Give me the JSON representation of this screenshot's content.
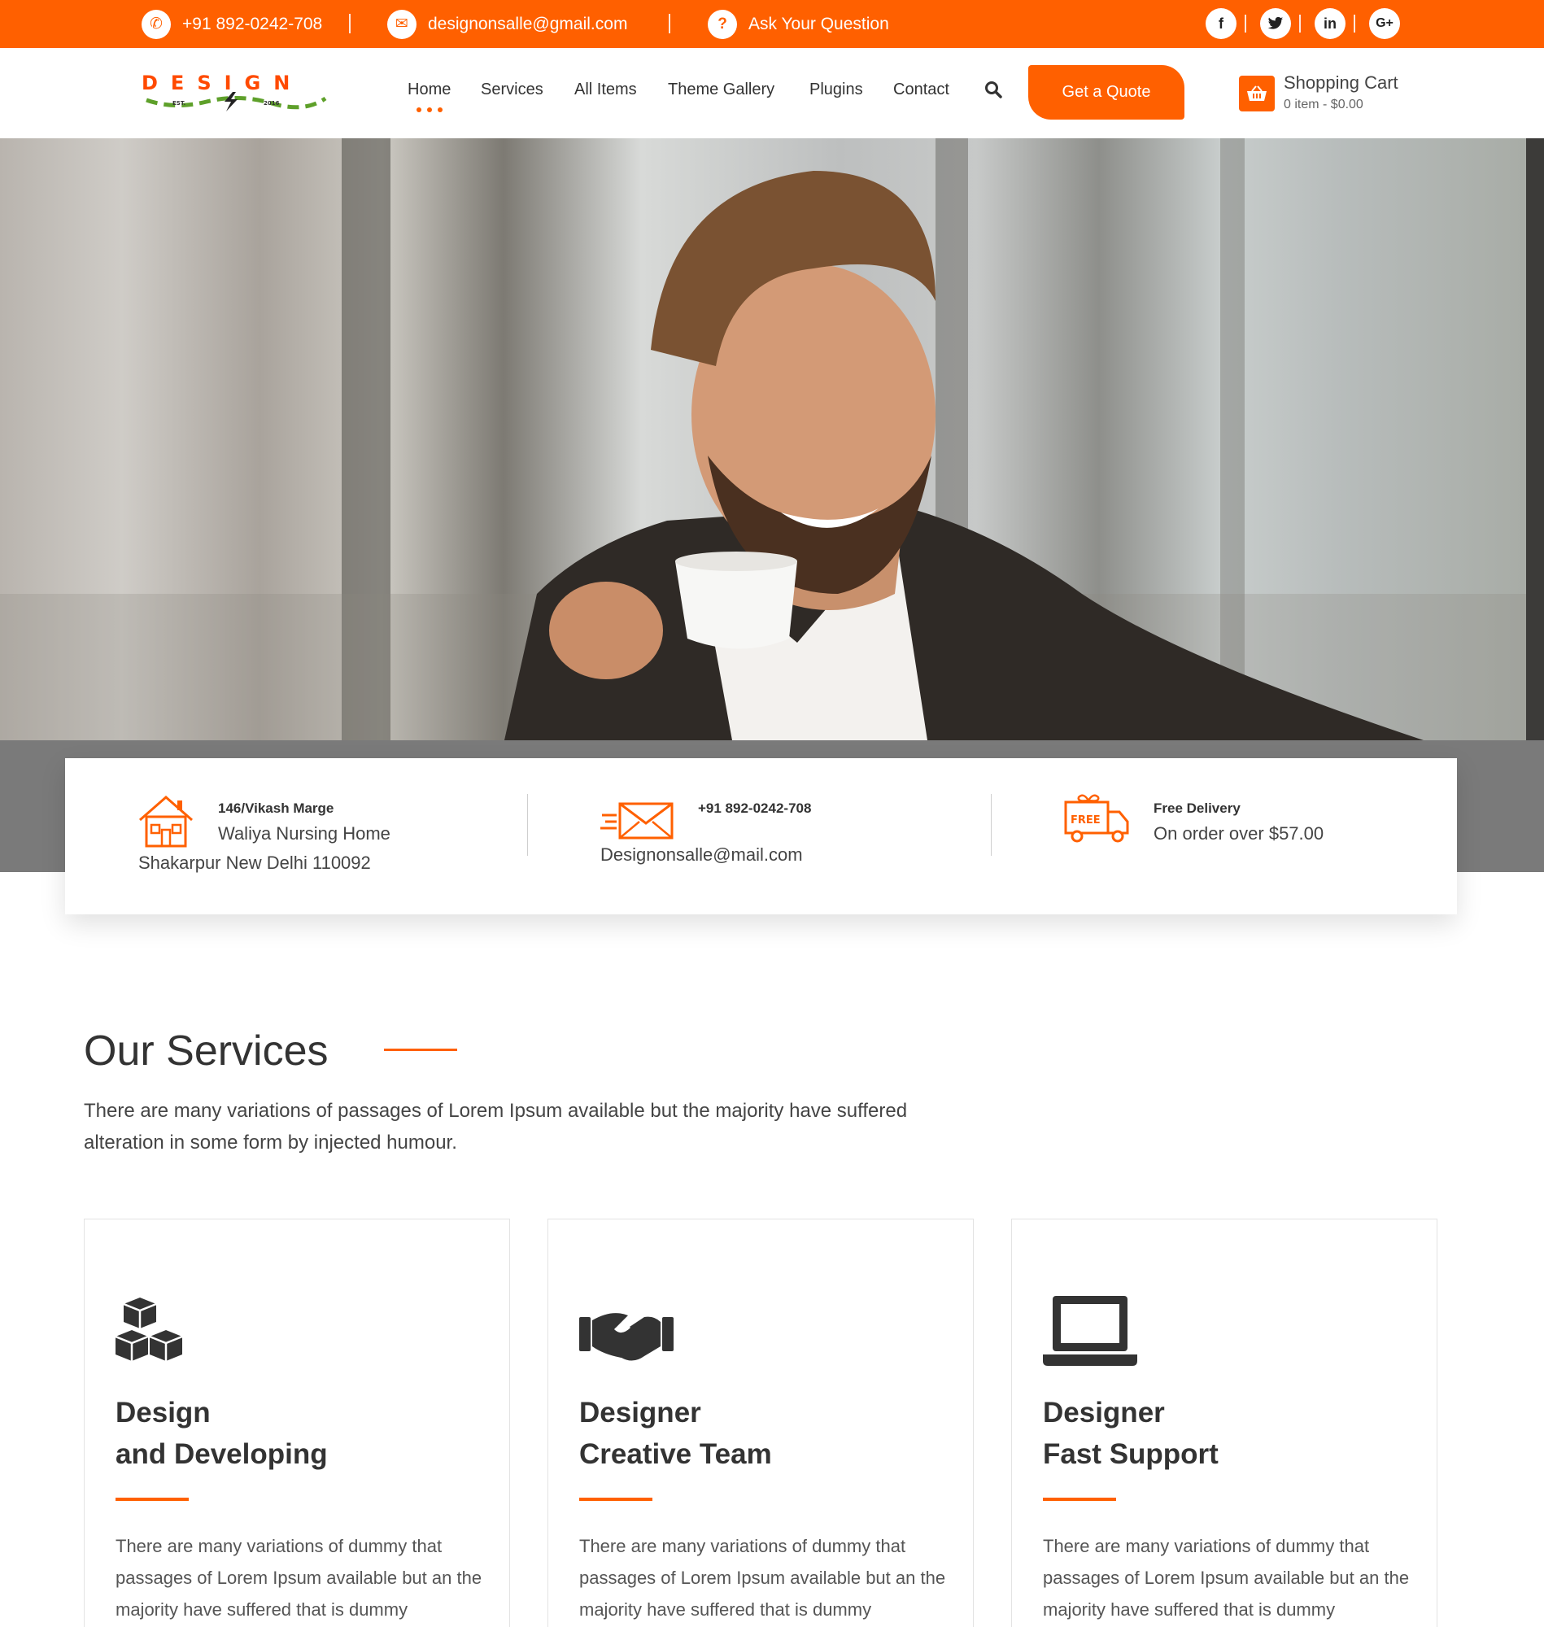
{
  "topbar": {
    "phone": "+91 892-0242-708",
    "email": "designonsalle@gmail.com",
    "question": "Ask Your Question",
    "social": [
      "f",
      "twitter",
      "in",
      "G+"
    ],
    "accent_color": "#ff6000"
  },
  "header": {
    "logo_text": "DESIGN",
    "logo_est_left": "EST.",
    "logo_est_right": "2016",
    "nav": [
      "Home",
      "Services",
      "All Items",
      "Theme Gallery",
      "Plugins",
      "Contact"
    ],
    "active_nav": "Home",
    "quote_button": "Get a Quote",
    "cart_title": "Shopping Cart",
    "cart_summary": "0 item - $0.00"
  },
  "info": {
    "address_line1": "146/Vikash Marge",
    "address_line2": "Waliya Nursing Home",
    "address_line3": "Shakarpur New Delhi 110092",
    "phone": "+91 892-0242-708",
    "email": "Designonsalle@mail.com",
    "delivery_title": "Free Delivery",
    "delivery_text": "On order over $57.00",
    "free_badge": "FREE"
  },
  "services": {
    "title": "Our Services",
    "description": "There are many variations of passages of Lorem Ipsum available but the majority have suffered alteration in some form by injected humour.",
    "cards": [
      {
        "title_line1": "Design",
        "title_line2": "and Developing",
        "icon": "cubes-icon",
        "text": "There are many variations of dummy that passages of Lorem Ipsum available but an the majority have suffered that is dummy"
      },
      {
        "title_line1": "Designer",
        "title_line2": "Creative Team",
        "icon": "handshake-icon",
        "text": "There are many variations of dummy that passages of Lorem Ipsum available but an the majority have suffered that is dummy"
      },
      {
        "title_line1": "Designer",
        "title_line2": "Fast Support",
        "icon": "laptop-icon",
        "text": "There are many variations of dummy that passages of Lorem Ipsum available but an the majority have suffered that is dummy"
      }
    ]
  }
}
